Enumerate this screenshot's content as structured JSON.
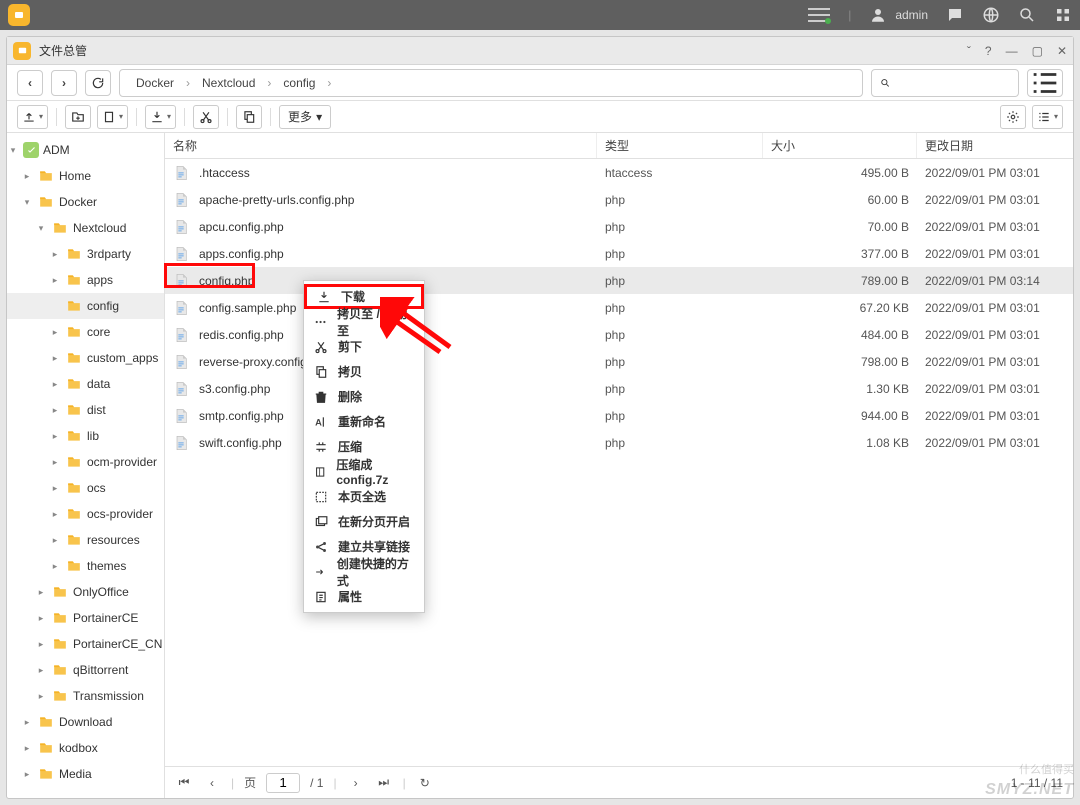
{
  "sysbar": {
    "user": "admin"
  },
  "window": {
    "title": "文件总管"
  },
  "breadcrumb": [
    "Docker",
    "Nextcloud",
    "config"
  ],
  "search": {
    "placeholder": ""
  },
  "columns": {
    "name": "名称",
    "type": "类型",
    "size": "大小",
    "date": "更改日期"
  },
  "more_label": "更多",
  "sidebar": {
    "root": "ADM",
    "items": [
      {
        "label": "Home",
        "depth": 1,
        "expand": "closed"
      },
      {
        "label": "Docker",
        "depth": 1,
        "expand": "open"
      },
      {
        "label": "Nextcloud",
        "depth": 2,
        "expand": "open"
      },
      {
        "label": "3rdparty",
        "depth": 3,
        "expand": "closed"
      },
      {
        "label": "apps",
        "depth": 3,
        "expand": "closed"
      },
      {
        "label": "config",
        "depth": 3,
        "expand": "none",
        "selected": true
      },
      {
        "label": "core",
        "depth": 3,
        "expand": "closed"
      },
      {
        "label": "custom_apps",
        "depth": 3,
        "expand": "closed"
      },
      {
        "label": "data",
        "depth": 3,
        "expand": "closed"
      },
      {
        "label": "dist",
        "depth": 3,
        "expand": "closed"
      },
      {
        "label": "lib",
        "depth": 3,
        "expand": "closed"
      },
      {
        "label": "ocm-provider",
        "depth": 3,
        "expand": "closed"
      },
      {
        "label": "ocs",
        "depth": 3,
        "expand": "closed"
      },
      {
        "label": "ocs-provider",
        "depth": 3,
        "expand": "closed"
      },
      {
        "label": "resources",
        "depth": 3,
        "expand": "closed"
      },
      {
        "label": "themes",
        "depth": 3,
        "expand": "closed"
      },
      {
        "label": "OnlyOffice",
        "depth": 2,
        "expand": "closed"
      },
      {
        "label": "PortainerCE",
        "depth": 2,
        "expand": "closed"
      },
      {
        "label": "PortainerCE_CN",
        "depth": 2,
        "expand": "closed"
      },
      {
        "label": "qBittorrent",
        "depth": 2,
        "expand": "closed"
      },
      {
        "label": "Transmission",
        "depth": 2,
        "expand": "closed"
      },
      {
        "label": "Download",
        "depth": 1,
        "expand": "closed"
      },
      {
        "label": "kodbox",
        "depth": 1,
        "expand": "closed"
      },
      {
        "label": "Media",
        "depth": 1,
        "expand": "closed"
      }
    ]
  },
  "files": [
    {
      "name": ".htaccess",
      "type": "htaccess",
      "size": "495.00 B",
      "date": "2022/09/01 PM 03:01"
    },
    {
      "name": "apache-pretty-urls.config.php",
      "type": "php",
      "size": "60.00 B",
      "date": "2022/09/01 PM 03:01"
    },
    {
      "name": "apcu.config.php",
      "type": "php",
      "size": "70.00 B",
      "date": "2022/09/01 PM 03:01"
    },
    {
      "name": "apps.config.php",
      "type": "php",
      "size": "377.00 B",
      "date": "2022/09/01 PM 03:01"
    },
    {
      "name": "config.php",
      "type": "php",
      "size": "789.00 B",
      "date": "2022/09/01 PM 03:14",
      "selected": true
    },
    {
      "name": "config.sample.php",
      "type": "php",
      "size": "67.20 KB",
      "date": "2022/09/01 PM 03:01"
    },
    {
      "name": "redis.config.php",
      "type": "php",
      "size": "484.00 B",
      "date": "2022/09/01 PM 03:01"
    },
    {
      "name": "reverse-proxy.config.ph",
      "type": "php",
      "size": "798.00 B",
      "date": "2022/09/01 PM 03:01"
    },
    {
      "name": "s3.config.php",
      "type": "php",
      "size": "1.30 KB",
      "date": "2022/09/01 PM 03:01"
    },
    {
      "name": "smtp.config.php",
      "type": "php",
      "size": "944.00 B",
      "date": "2022/09/01 PM 03:01"
    },
    {
      "name": "swift.config.php",
      "type": "php",
      "size": "1.08 KB",
      "date": "2022/09/01 PM 03:01"
    }
  ],
  "context_menu": [
    {
      "label": "下载",
      "icon": "download",
      "hl": true
    },
    {
      "label": "拷贝至 / 移动至",
      "icon": "dots"
    },
    {
      "label": "剪下",
      "icon": "cut"
    },
    {
      "label": "拷贝",
      "icon": "copy"
    },
    {
      "label": "删除",
      "icon": "trash"
    },
    {
      "label": "重新命名",
      "icon": "rename"
    },
    {
      "label": "压缩",
      "icon": "compress"
    },
    {
      "label": "压缩成config.7z",
      "icon": "archive"
    },
    {
      "label": "本页全选",
      "icon": "selectall"
    },
    {
      "label": "在新分页开启",
      "icon": "newtab"
    },
    {
      "label": "建立共享链接",
      "icon": "share"
    },
    {
      "label": "创建快捷的方式",
      "icon": "shortcut"
    },
    {
      "label": "属性",
      "icon": "info"
    }
  ],
  "pager": {
    "page_label_pre": "页",
    "page": "1",
    "page_label_post": "/ 1",
    "range": "1 - 11 / 11"
  },
  "watermark": {
    "main": "SMYZ.NET",
    "sub": "什么值得买"
  }
}
